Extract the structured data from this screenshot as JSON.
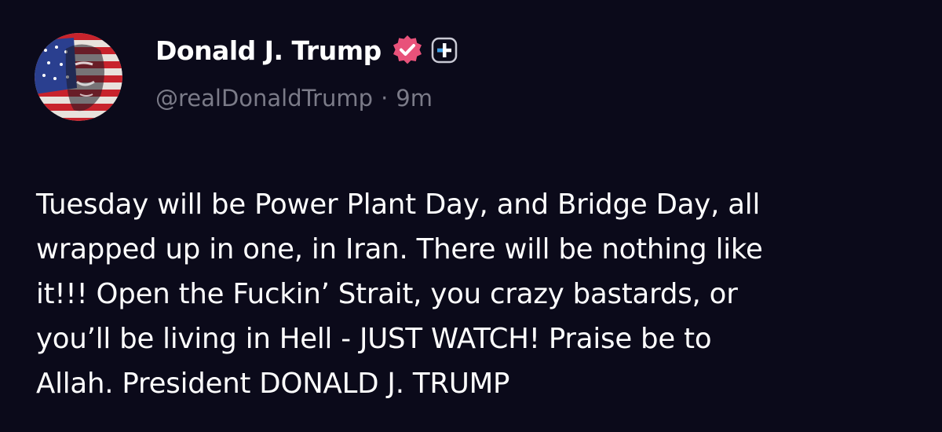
{
  "author": {
    "display_name": "Donald J. Trump",
    "handle": "@realDonaldTrump",
    "separator": "·",
    "time_ago": "9m",
    "verified_icon": "verified-badge-icon",
    "plus_icon": "plus-badge-icon",
    "avatar_icon": "avatar"
  },
  "post": {
    "text": "Tuesday will be Power Plant Day, and Bridge Day, all\nwrapped up in one, in Iran. There will be nothing like\nit!!! Open the Fuckin’ Strait, you crazy bastards, or\nyou’ll be living in Hell - JUST WATCH! Praise be to\nAllah. President DONALD J. TRUMP"
  },
  "colors": {
    "background": "#0b0a1a",
    "text": "#ffffff",
    "muted": "#7b7b88",
    "verified": "#e8527a"
  }
}
